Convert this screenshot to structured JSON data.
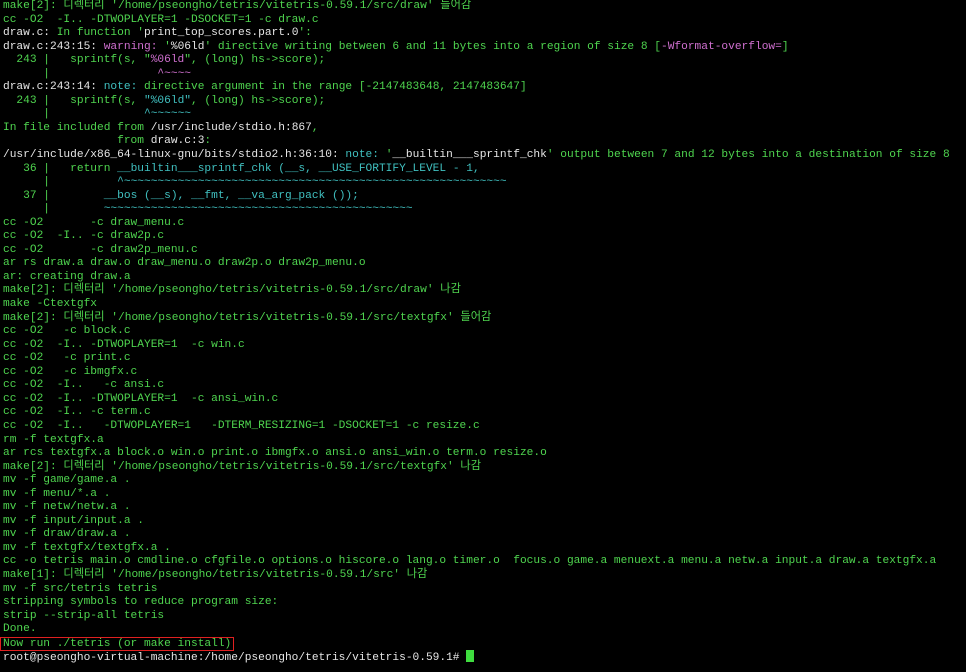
{
  "terminal": {
    "lines": [
      [
        {
          "t": "make[2]: 디렉터리 '/home/pseongho/tetris/vitetris-0.59.1/src/draw' 들어감",
          "c": "green"
        }
      ],
      [
        {
          "t": "cc -O2  -I.. -DTWOPLAYER=1 -DSOCKET=1 -c draw.c",
          "c": "green"
        }
      ],
      [
        {
          "t": "draw.c:",
          "c": "white"
        },
        {
          "t": " In function '",
          "c": "green"
        },
        {
          "t": "print_top_scores.part.0",
          "c": "white"
        },
        {
          "t": "':",
          "c": "green"
        }
      ],
      [
        {
          "t": "draw.c:243:15: ",
          "c": "white"
        },
        {
          "t": "warning: ",
          "c": "magenta"
        },
        {
          "t": "'",
          "c": "green"
        },
        {
          "t": "%06ld",
          "c": "white"
        },
        {
          "t": "' directive writing between 6 and 11 bytes into a region of size 8 [",
          "c": "green"
        },
        {
          "t": "-Wformat-overflow=",
          "c": "magenta"
        },
        {
          "t": "]",
          "c": "green"
        }
      ],
      [
        {
          "t": "  243 |   sprintf(s, \"",
          "c": "green"
        },
        {
          "t": "%06ld",
          "c": "magenta"
        },
        {
          "t": "\", (long) hs->score);",
          "c": "green"
        }
      ],
      [
        {
          "t": "      |                ",
          "c": "green"
        },
        {
          "t": "^~~~~",
          "c": "magenta"
        }
      ],
      [
        {
          "t": "draw.c:243:14: ",
          "c": "white"
        },
        {
          "t": "note: ",
          "c": "cyan"
        },
        {
          "t": "directive argument in the range [-2147483648, 2147483647]",
          "c": "green"
        }
      ],
      [
        {
          "t": "  243 |   sprintf(s, ",
          "c": "green"
        },
        {
          "t": "\"%06ld\"",
          "c": "cyan"
        },
        {
          "t": ", (long) hs->score);",
          "c": "green"
        }
      ],
      [
        {
          "t": "      |              ",
          "c": "green"
        },
        {
          "t": "^~~~~~~",
          "c": "cyan"
        }
      ],
      [
        {
          "t": "In file included from ",
          "c": "green"
        },
        {
          "t": "/usr/include/stdio.h:867",
          "c": "white"
        },
        {
          "t": ",",
          "c": "green"
        }
      ],
      [
        {
          "t": "                 from ",
          "c": "green"
        },
        {
          "t": "draw.c:3",
          "c": "white"
        },
        {
          "t": ":",
          "c": "green"
        }
      ],
      [
        {
          "t": "/usr/include/x86_64-linux-gnu/bits/stdio2.h:36:10: ",
          "c": "white"
        },
        {
          "t": "note: ",
          "c": "cyan"
        },
        {
          "t": "'",
          "c": "green"
        },
        {
          "t": "__builtin___sprintf_chk",
          "c": "white"
        },
        {
          "t": "' output between 7 and 12 bytes into a destination of size 8",
          "c": "green"
        }
      ],
      [
        {
          "t": "   36 |   return ",
          "c": "green"
        },
        {
          "t": "__builtin___sprintf_chk (__s, __USE_FORTIFY_LEVEL - 1,",
          "c": "cyan"
        }
      ],
      [
        {
          "t": "      |          ",
          "c": "green"
        },
        {
          "t": "^~~~~~~~~~~~~~~~~~~~~~~~~~~~~~~~~~~~~~~~~~~~~~~~~~~~~~~~~~",
          "c": "cyan"
        }
      ],
      [
        {
          "t": "   37 |        ",
          "c": "green"
        },
        {
          "t": "__bos (__s), __fmt, __va_arg_pack ());",
          "c": "cyan"
        }
      ],
      [
        {
          "t": "      |        ",
          "c": "green"
        },
        {
          "t": "~~~~~~~~~~~~~~~~~~~~~~~~~~~~~~~~~~~~~~~~~~~~~~",
          "c": "cyan"
        }
      ],
      [
        {
          "t": "cc -O2       -c draw_menu.c",
          "c": "green"
        }
      ],
      [
        {
          "t": "cc -O2  -I.. -c draw2p.c",
          "c": "green"
        }
      ],
      [
        {
          "t": "cc -O2       -c draw2p_menu.c",
          "c": "green"
        }
      ],
      [
        {
          "t": "ar rs draw.a draw.o draw_menu.o draw2p.o draw2p_menu.o",
          "c": "green"
        }
      ],
      [
        {
          "t": "ar: creating draw.a",
          "c": "green"
        }
      ],
      [
        {
          "t": "make[2]: 디렉터리 '/home/pseongho/tetris/vitetris-0.59.1/src/draw' 나감",
          "c": "green"
        }
      ],
      [
        {
          "t": "make -Ctextgfx",
          "c": "green"
        }
      ],
      [
        {
          "t": "make[2]: 디렉터리 '/home/pseongho/tetris/vitetris-0.59.1/src/textgfx' 들어감",
          "c": "green"
        }
      ],
      [
        {
          "t": "cc -O2   -c block.c",
          "c": "green"
        }
      ],
      [
        {
          "t": "cc -O2  -I.. -DTWOPLAYER=1  -c win.c",
          "c": "green"
        }
      ],
      [
        {
          "t": "cc -O2   -c print.c",
          "c": "green"
        }
      ],
      [
        {
          "t": "cc -O2   -c ibmgfx.c",
          "c": "green"
        }
      ],
      [
        {
          "t": "cc -O2  -I..   -c ansi.c",
          "c": "green"
        }
      ],
      [
        {
          "t": "cc -O2  -I.. -DTWOPLAYER=1  -c ansi_win.c",
          "c": "green"
        }
      ],
      [
        {
          "t": "cc -O2  -I.. -c term.c",
          "c": "green"
        }
      ],
      [
        {
          "t": "cc -O2  -I..   -DTWOPLAYER=1   -DTERM_RESIZING=1 -DSOCKET=1 -c resize.c",
          "c": "green"
        }
      ],
      [
        {
          "t": "rm -f textgfx.a",
          "c": "green"
        }
      ],
      [
        {
          "t": "ar rcs textgfx.a block.o win.o print.o ibmgfx.o ansi.o ansi_win.o term.o resize.o",
          "c": "green"
        }
      ],
      [
        {
          "t": "make[2]: 디렉터리 '/home/pseongho/tetris/vitetris-0.59.1/src/textgfx' 나감",
          "c": "green"
        }
      ],
      [
        {
          "t": "mv -f game/game.a .",
          "c": "green"
        }
      ],
      [
        {
          "t": "mv -f menu/*.a .",
          "c": "green"
        }
      ],
      [
        {
          "t": "mv -f netw/netw.a .",
          "c": "green"
        }
      ],
      [
        {
          "t": "mv -f input/input.a .",
          "c": "green"
        }
      ],
      [
        {
          "t": "mv -f draw/draw.a .",
          "c": "green"
        }
      ],
      [
        {
          "t": "mv -f textgfx/textgfx.a .",
          "c": "green"
        }
      ],
      [
        {
          "t": "cc -o tetris main.o cmdline.o cfgfile.o options.o hiscore.o lang.o timer.o  focus.o game.a menuext.a menu.a netw.a input.a draw.a textgfx.a",
          "c": "green"
        }
      ],
      [
        {
          "t": "make[1]: 디렉터리 '/home/pseongho/tetris/vitetris-0.59.1/src' 나감",
          "c": "green"
        }
      ],
      [
        {
          "t": "mv -f src/tetris tetris",
          "c": "green"
        }
      ],
      [
        {
          "t": "stripping symbols to reduce program size:",
          "c": "green"
        }
      ],
      [
        {
          "t": "strip --strip-all tetris",
          "c": "green"
        }
      ],
      [
        {
          "t": "Done.",
          "c": "green"
        }
      ]
    ],
    "highlighted_line": "Now run ./tetris (or make install)",
    "prompt": "root@pseongho-virtual-machine:/home/pseongho/tetris/vitetris-0.59.1#"
  },
  "colors": {
    "background": "#000000",
    "green": "#4fd54f",
    "white": "#e6e6e6",
    "magenta": "#d070d0",
    "cyan": "#40c0c0",
    "highlight_border": "#e02020",
    "cursor": "#3fdc3f"
  }
}
